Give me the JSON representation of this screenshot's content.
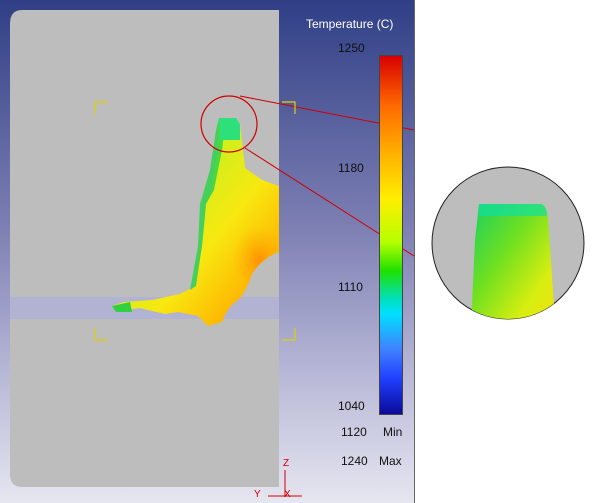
{
  "legend": {
    "title": "Temperature (C)",
    "ticks": [
      "1250",
      "1180",
      "1110",
      "1040"
    ],
    "min_value": "1120",
    "min_label": "Min",
    "max_value": "1240",
    "max_label": "Max"
  },
  "axes": {
    "z": "Z",
    "y": "Y",
    "x": "X"
  },
  "colors": {
    "background_top": "#2f3f86",
    "background_bottom": "#e6e6f0",
    "die": "#bdbdbd",
    "callout_line": "#d00000",
    "bracket": "#e0d000"
  },
  "icons": [
    "zoom-callout-icon",
    "axis-triad-icon"
  ]
}
